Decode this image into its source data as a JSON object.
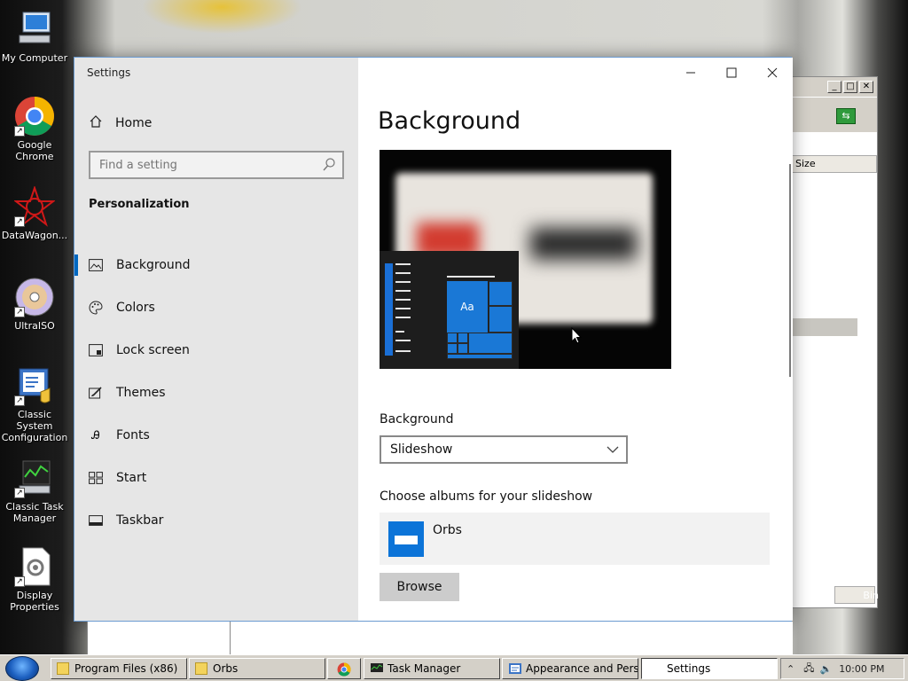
{
  "desktop": {
    "icons": [
      {
        "label": "My Computer",
        "icon": "computer-icon"
      },
      {
        "label": "Google Chrome",
        "icon": "chrome-icon"
      },
      {
        "label": "DataWagon...",
        "icon": "datawagon-icon"
      },
      {
        "label": "UltraISO",
        "icon": "disc-icon"
      },
      {
        "label": "Classic System Configuration",
        "icon": "system-config-icon"
      },
      {
        "label": "Classic Task Manager",
        "icon": "task-manager-icon"
      },
      {
        "label": "Display Properties",
        "icon": "display-properties-icon"
      }
    ]
  },
  "bg_window": {
    "column_header": "Size",
    "right_edge_text": "Bin"
  },
  "settings": {
    "app_title": "Settings",
    "home_label": "Home",
    "search_placeholder": "Find a setting",
    "section_title": "Personalization",
    "nav": [
      {
        "label": "Background",
        "icon": "image-icon",
        "active": true
      },
      {
        "label": "Colors",
        "icon": "palette-icon",
        "active": false
      },
      {
        "label": "Lock screen",
        "icon": "lock-screen-icon",
        "active": false
      },
      {
        "label": "Themes",
        "icon": "brush-icon",
        "active": false
      },
      {
        "label": "Fonts",
        "icon": "font-icon",
        "active": false
      },
      {
        "label": "Start",
        "icon": "start-icon",
        "active": false
      },
      {
        "label": "Taskbar",
        "icon": "taskbar-icon",
        "active": false
      }
    ],
    "page_title": "Background",
    "preview_tile_text": "Aa",
    "background_label": "Background",
    "background_value": "Slideshow",
    "albums_label": "Choose albums for your slideshow",
    "album_name": "Orbs",
    "browse_label": "Browse"
  },
  "taskbar": {
    "buttons": [
      {
        "label": "Program Files (x86)",
        "icon": "folder-icon"
      },
      {
        "label": "Orbs",
        "icon": "folder-icon"
      },
      {
        "label": "",
        "icon": "chrome-icon"
      },
      {
        "label": "Task Manager",
        "icon": "task-manager-icon"
      },
      {
        "label": "Appearance and Pers...",
        "icon": "control-panel-icon"
      },
      {
        "label": "Settings",
        "icon": "",
        "active": true
      }
    ],
    "clock": "10:00 PM"
  }
}
